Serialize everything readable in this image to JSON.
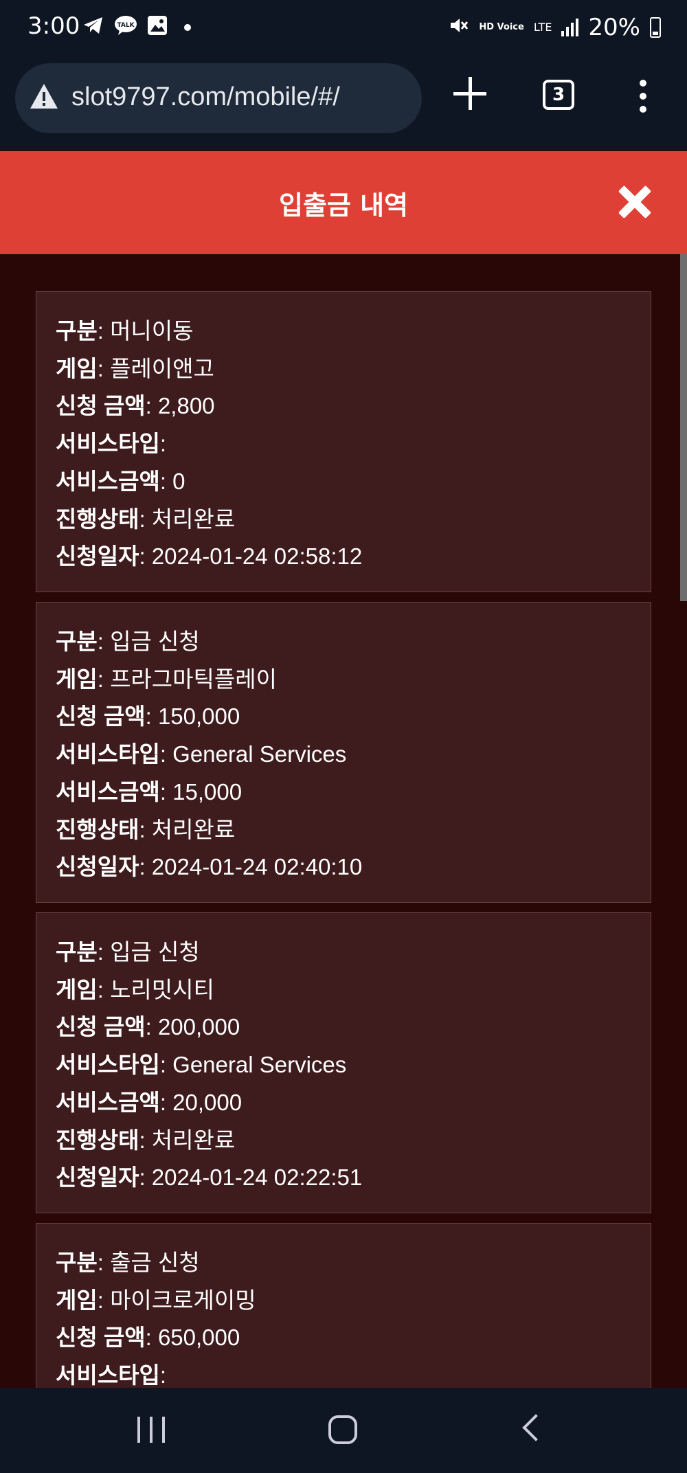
{
  "status_bar": {
    "time": "3:00",
    "battery": "20%",
    "hd_label": "HD Voice",
    "lte_label": "LTE"
  },
  "browser": {
    "url": "slot9797.com/mobile/#/",
    "tab_count": "3"
  },
  "modal": {
    "title": "입출금 내역"
  },
  "labels": {
    "category": "구분",
    "game": "게임",
    "amount": "신청 금액",
    "service_type": "서비스타입",
    "service_amount": "서비스금액",
    "status": "진행상태",
    "date": "신청일자"
  },
  "records": [
    {
      "category": ": 머니이동",
      "game": ": 플레이앤고",
      "amount": ": 2,800",
      "service_type": ":",
      "service_amount": ": 0",
      "status": ": 처리완료",
      "date": ": 2024-01-24 02:58:12"
    },
    {
      "category": ": 입금 신청",
      "game": ": 프라그마틱플레이",
      "amount": ": 150,000",
      "service_type": ": General Services",
      "service_amount": ": 15,000",
      "status": ": 처리완료",
      "date": ": 2024-01-24 02:40:10"
    },
    {
      "category": ": 입금 신청",
      "game": ": 노리밋시티",
      "amount": ": 200,000",
      "service_type": ": General Services",
      "service_amount": ": 20,000",
      "status": ": 처리완료",
      "date": ": 2024-01-24 02:22:51"
    },
    {
      "category": ": 출금 신청",
      "game": ": 마이크로게이밍",
      "amount": ": 650,000",
      "service_type": ":"
    }
  ],
  "colors": {
    "header_red": "#de4035",
    "card_bg": "#3e1b1c",
    "page_bg": "#2a0707",
    "system_bar": "#0f1623"
  }
}
